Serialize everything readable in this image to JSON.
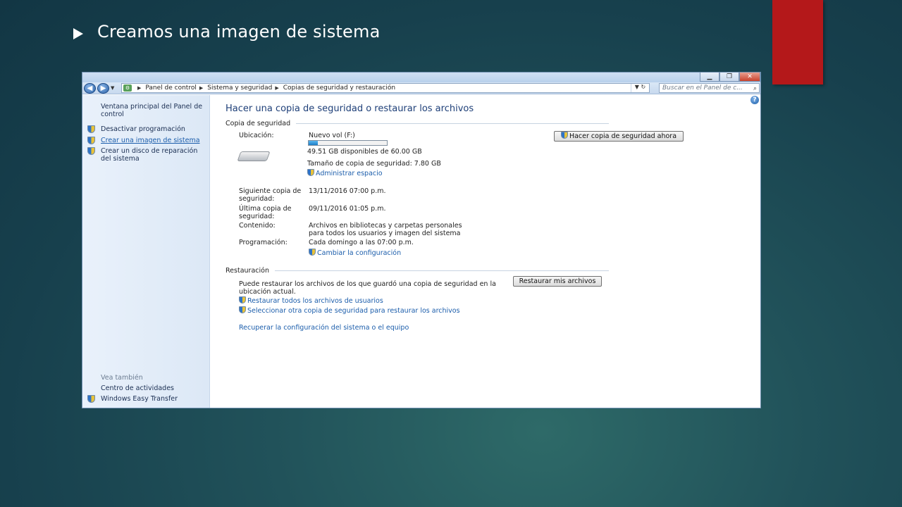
{
  "slide": {
    "title": "Creamos una imagen de sistema"
  },
  "window": {
    "buttons": {
      "minimize": "▁",
      "maximize": "❐",
      "close": "✕"
    },
    "breadcrumbs": [
      "Panel de control",
      "Sistema y seguridad",
      "Copias de seguridad y restauración"
    ],
    "search_placeholder": "Buscar en el Panel de c..."
  },
  "sidebar": {
    "home": "Ventana principal del Panel de control",
    "items": [
      {
        "label": "Desactivar programación",
        "icon": "shield-icon"
      },
      {
        "label": "Crear una imagen de sistema",
        "icon": "shield-icon"
      },
      {
        "label": "Crear un disco de reparación del sistema",
        "icon": "shield-icon"
      }
    ],
    "see_also": "Vea también",
    "see_also_items": [
      {
        "label": "Centro de actividades"
      },
      {
        "label": "Windows Easy Transfer",
        "icon": "shield-icon"
      }
    ]
  },
  "main": {
    "title": "Hacer una copia de seguridad o restaurar los archivos",
    "backup": {
      "heading": "Copia de seguridad",
      "location_label": "Ubicación:",
      "location_value": "Nuevo vol (F:)",
      "usage_fraction": 0.12,
      "free_space": "49.51 GB disponibles de 60.00 GB",
      "backup_size": "Tamaño de copia de seguridad: 7.80 GB",
      "manage_space": "Administrar espacio",
      "backup_now_button": "Hacer copia de seguridad ahora",
      "next_label": "Siguiente copia de seguridad:",
      "next_value": "13/11/2016 07:00 p.m.",
      "last_label": "Última copia de seguridad:",
      "last_value": "09/11/2016 01:05 p.m.",
      "content_label": "Contenido:",
      "content_value": "Archivos en bibliotecas y carpetas personales para todos los usuarios y imagen del sistema",
      "schedule_label": "Programación:",
      "schedule_value": "Cada domingo a las 07:00 p.m.",
      "change_settings": "Cambiar la configuración"
    },
    "restore": {
      "heading": "Restauración",
      "description": "Puede restaurar los archivos de los que guardó una copia de seguridad en la ubicación actual.",
      "restore_my_files_button": "Restaurar mis archivos",
      "restore_all_users": "Restaurar todos los archivos de usuarios",
      "select_other_backup": "Seleccionar otra copia de seguridad para restaurar los archivos",
      "recover_system": "Recuperar la configuración del sistema o el equipo"
    }
  },
  "colors": {
    "red_tab": "#b4181a",
    "link": "#1b5dab",
    "title": "#1e3f78"
  }
}
